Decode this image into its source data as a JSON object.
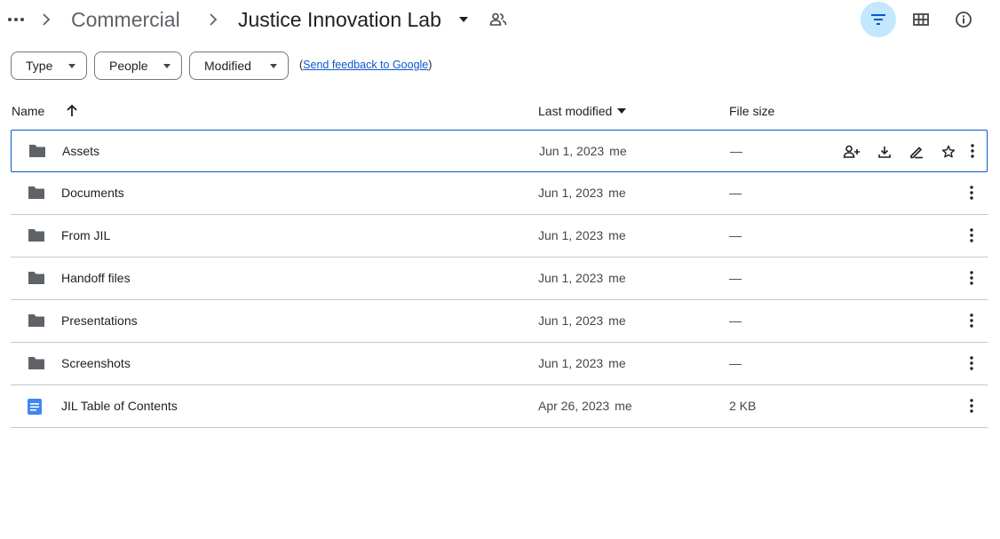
{
  "breadcrumb": {
    "parent": "Commercial",
    "current": "Justice Innovation Lab"
  },
  "filters": {
    "type": "Type",
    "people": "People",
    "modified": "Modified",
    "feedback_open": "(",
    "feedback_link": "Send feedback to Google",
    "feedback_close": ")"
  },
  "columns": {
    "name": "Name",
    "last_modified": "Last modified",
    "file_size": "File size"
  },
  "files": [
    {
      "name": "Assets",
      "date": "Jun 1, 2023",
      "owner": "me",
      "size": "—",
      "kind": "folder",
      "selected": true
    },
    {
      "name": "Documents",
      "date": "Jun 1, 2023",
      "owner": "me",
      "size": "—",
      "kind": "folder"
    },
    {
      "name": "From JIL",
      "date": "Jun 1, 2023",
      "owner": "me",
      "size": "—",
      "kind": "folder"
    },
    {
      "name": "Handoff files",
      "date": "Jun 1, 2023",
      "owner": "me",
      "size": "—",
      "kind": "folder"
    },
    {
      "name": "Presentations",
      "date": "Jun 1, 2023",
      "owner": "me",
      "size": "—",
      "kind": "folder"
    },
    {
      "name": "Screenshots",
      "date": "Jun 1, 2023",
      "owner": "me",
      "size": "—",
      "kind": "folder"
    },
    {
      "name": "JIL Table of Contents",
      "date": "Apr 26, 2023",
      "owner": "me",
      "size": "2 KB",
      "kind": "doc"
    }
  ],
  "icons": {
    "header": [
      "more-horiz-icon",
      "chevron-right-icon",
      "arrow-drop-down-icon",
      "shared-people-icon",
      "filter-icon",
      "grid-view-icon",
      "info-icon"
    ],
    "row_actions": [
      "add-person-icon",
      "download-icon",
      "rename-icon",
      "star-icon",
      "more-vert-icon"
    ],
    "sort": "arrow-up-icon"
  },
  "colors": {
    "accent": "#0b57d0",
    "active_button_bg": "#c2e7ff",
    "folder": "#5f6368",
    "doc": "#4285f4",
    "divider": "#c4c7c5"
  }
}
